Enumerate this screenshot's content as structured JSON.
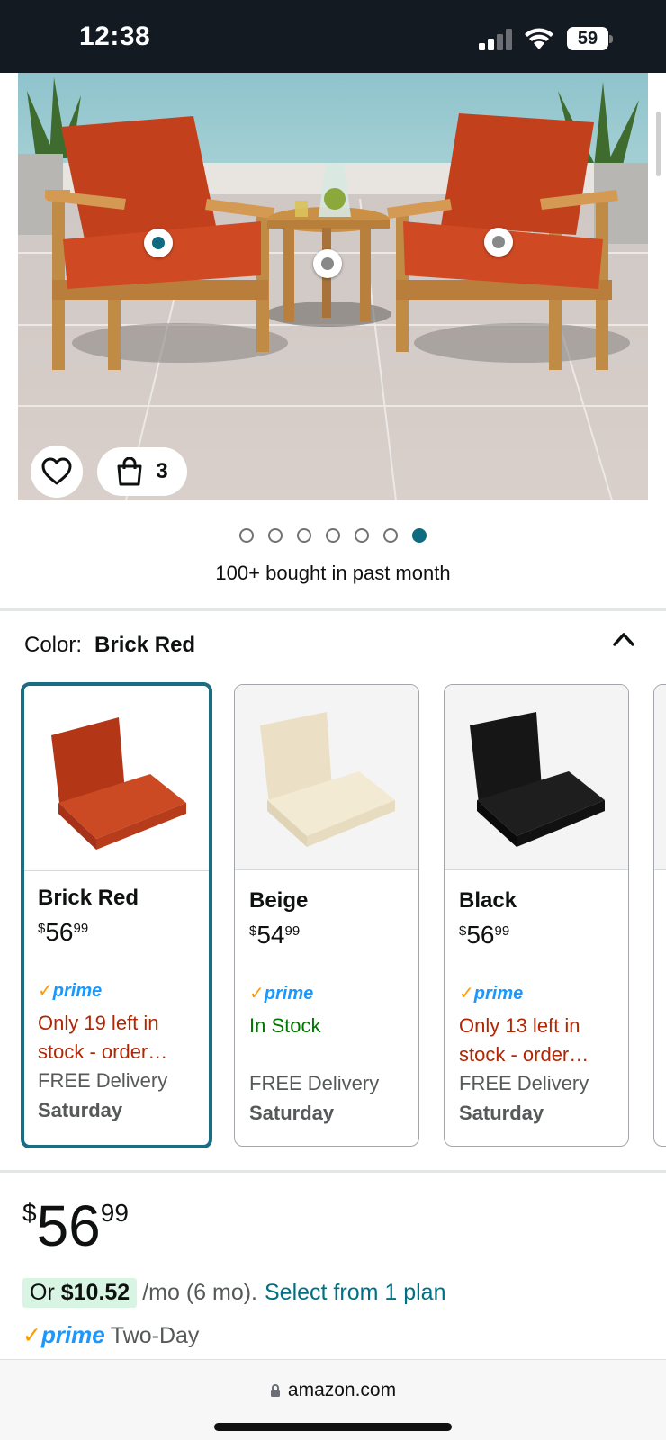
{
  "status_bar": {
    "time": "12:38",
    "battery": "59"
  },
  "hero": {
    "bag_count": "3",
    "page_count": 7,
    "active_page": 6
  },
  "social_proof": "100+ bought in past month",
  "color": {
    "label": "Color:",
    "selected": "Brick Red",
    "options": [
      {
        "name": "Brick Red",
        "price_whole": "56",
        "price_cents": "99",
        "currency": "$",
        "prime": "prime",
        "stock": "Only 19 left in stock - order…",
        "stock_type": "low",
        "delivery": "FREE Delivery",
        "delivery_day": "Saturday",
        "swatch": "#c0391f"
      },
      {
        "name": "Beige",
        "price_whole": "54",
        "price_cents": "99",
        "currency": "$",
        "prime": "prime",
        "stock": "In Stock",
        "stock_type": "ok",
        "delivery": "FREE Delivery",
        "delivery_day": "Saturday",
        "swatch": "#efe6cf"
      },
      {
        "name": "Black",
        "price_whole": "56",
        "price_cents": "99",
        "currency": "$",
        "prime": "prime",
        "stock": "Only 13 left in stock - order…",
        "stock_type": "low",
        "delivery": "FREE Delivery",
        "delivery_day": "Saturday",
        "swatch": "#141414"
      }
    ]
  },
  "price": {
    "currency": "$",
    "whole": "56",
    "cents": "99",
    "installment_prefix": "Or",
    "installment_amount": "$10.52",
    "installment_term": "/mo (6 mo).",
    "installment_link": "Select from 1 plan"
  },
  "shipping": {
    "prime": "prime",
    "speed": "Two-Day"
  },
  "browser": {
    "url": "amazon.com"
  },
  "colors": {
    "teal": "#0e6b80",
    "prime_blue": "#1a98ff",
    "prime_orange": "#ff9900",
    "low_stock": "#b12704",
    "in_stock": "#007600",
    "link": "#007185"
  }
}
